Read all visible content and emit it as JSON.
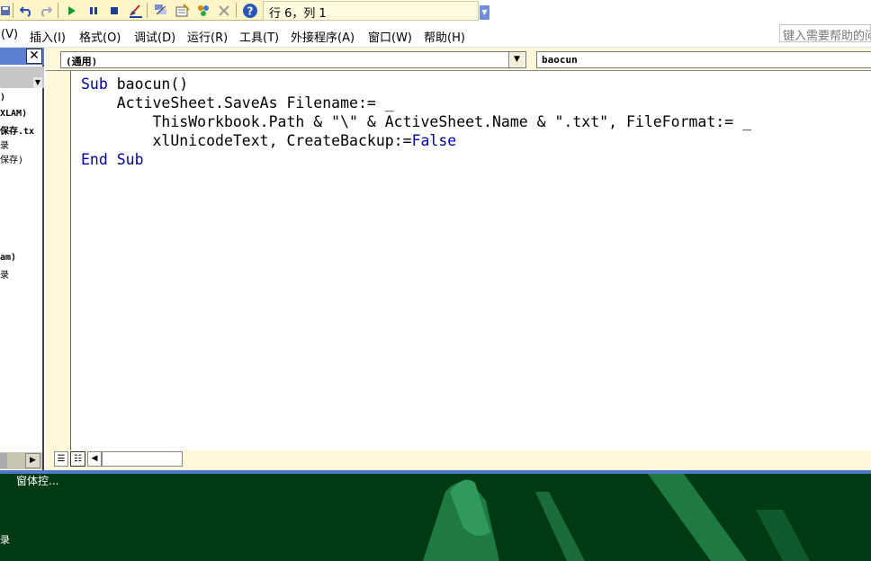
{
  "toolbar": {
    "status_text": "行 6，列 1",
    "icons": [
      "save-icon",
      "undo-icon",
      "redo-icon",
      "run-icon",
      "pause-icon",
      "stop-icon",
      "design-mode-icon",
      "project-explorer-icon",
      "properties-icon",
      "object-browser-icon",
      "toolbox-icon",
      "help-icon"
    ]
  },
  "menu": {
    "items": [
      "(V)",
      "插入(I)",
      "格式(O)",
      "调试(D)",
      "运行(R)",
      "工具(T)",
      "外接程序(A)",
      "窗口(W)",
      "帮助(H)"
    ],
    "help_placeholder": "键入需要帮助的问"
  },
  "project_panel": {
    "tree": [
      ")",
      "XLAM)",
      "保存.tx",
      "录",
      "保存)",
      "am)",
      "录"
    ]
  },
  "code_window": {
    "object_combo": "(通用)",
    "procedure_combo": "baocun",
    "lines": [
      {
        "plain": "",
        "kw1": "Sub",
        "rest": " baocun()",
        "kw2": "",
        "tail": ""
      },
      {
        "plain": "    ActiveSheet.SaveAs Filename:= _",
        "kw1": "",
        "rest": "",
        "kw2": "",
        "tail": ""
      },
      {
        "plain": "        ThisWorkbook.Path & \"\\\" & ActiveSheet.Name & \".txt\", FileFormat:= _",
        "kw1": "",
        "rest": "",
        "kw2": "",
        "tail": ""
      },
      {
        "plain": "        xlUnicodeText, CreateBackup:=",
        "kw1": "",
        "rest": "",
        "kw2": "False",
        "tail": ""
      },
      {
        "plain": "",
        "kw1": "End",
        "rest": " ",
        "kw2": "Sub",
        "tail": ""
      }
    ]
  },
  "bottom_panel": {
    "text_top": "窗体控...",
    "text_bottom": "录"
  },
  "colors": {
    "keyword": "#0000a8",
    "code_header": "#fff7d9",
    "title_blue": "#5a7fd3",
    "bottom_green": "#003a12"
  }
}
